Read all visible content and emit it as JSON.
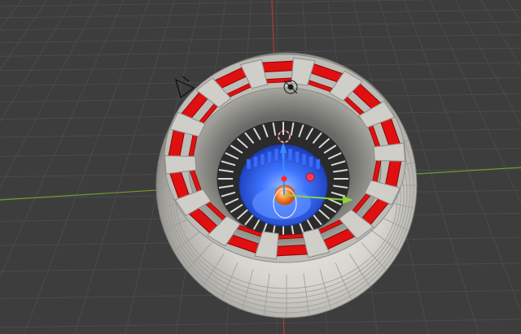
{
  "viewport": {
    "view": "3D Viewport",
    "background_color": "#3d3d3d",
    "grid_color": "#4a4a4a",
    "x_axis_color": "#7ca331",
    "z_axis_color": "#bf3a3a"
  },
  "scene": {
    "object": "arc-reactor-mesh",
    "object_icons": [
      "camera-icon",
      "light-icon"
    ],
    "gizmo": "transform-gizmo",
    "colors": {
      "ring_red": "#e01010",
      "ring_silver": "#c7c7c2",
      "core_blue": "#2f63e8",
      "core_orange": "#ff8a30",
      "gizmo_red": "#ff2a2a",
      "gizmo_green": "#8cd43a",
      "gizmo_blue": "#3a8bff"
    }
  }
}
